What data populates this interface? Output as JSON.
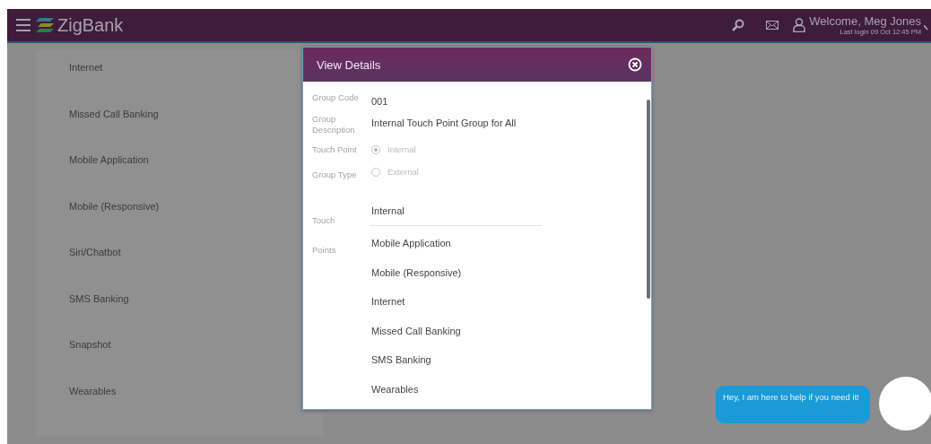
{
  "header": {
    "brand": "ZigBank",
    "welcome": "Welcome, Meg Jones",
    "last_login": "Last login 09 Oct 12:45 PM"
  },
  "background_list": [
    "Internet",
    "Missed Call Banking",
    "Mobile Application",
    "Mobile (Responsive)",
    "Siri/Chatbot",
    "SMS Banking",
    "Snapshot",
    "Wearables"
  ],
  "modal": {
    "title": "View Details",
    "fields": [
      {
        "label": "Group Code",
        "value": "001"
      },
      {
        "label": "Group Description",
        "value": "Internal Touch Point Group for All"
      }
    ],
    "touch_point": {
      "label": "Touch Point",
      "options": [
        {
          "label": "Internal",
          "selected": true
        },
        {
          "label": "External",
          "selected": false
        }
      ]
    },
    "group_type_label": "Group Type",
    "touch_points": {
      "label": "Touch Points",
      "group": "Internal",
      "items": [
        "Mobile Application",
        "Mobile (Responsive)",
        "Internet",
        "Missed Call Banking",
        "SMS Banking",
        "Wearables"
      ]
    }
  },
  "chat": {
    "message": "Hey, I am here to help if you need it!"
  }
}
